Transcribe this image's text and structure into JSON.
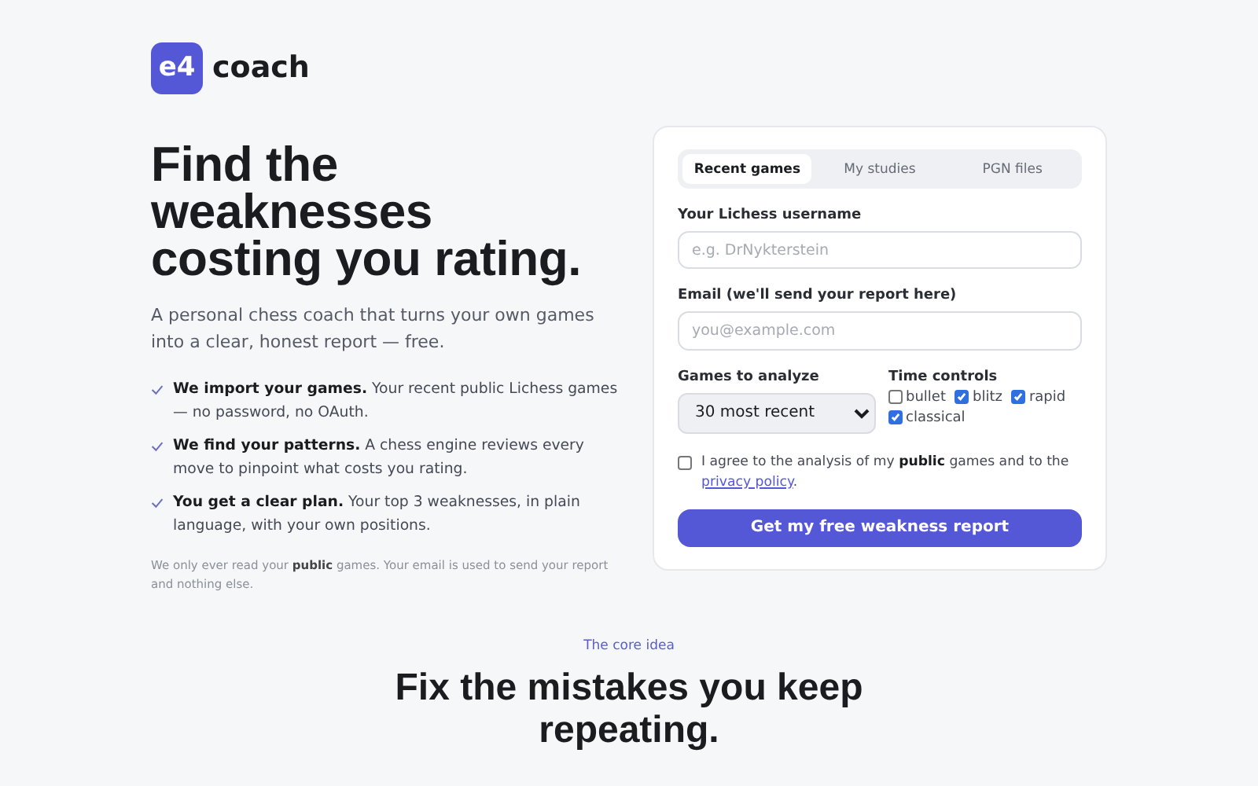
{
  "brand": {
    "mark": "e4",
    "name": "coach"
  },
  "hero": {
    "title_lines": [
      "Find the",
      "weaknesses",
      "costing you rating."
    ],
    "subtitle": "A personal chess coach that turns your own games into a clear, honest report — free.",
    "features": [
      {
        "lead": "We import your games.",
        "text": "Your recent public Lichess games — no password, no OAuth."
      },
      {
        "lead": "We find your patterns.",
        "text": "A chess engine reviews every move to pinpoint what costs you rating."
      },
      {
        "lead": "You get a clear plan.",
        "text": "Your top 3 weaknesses, in plain language, with your own positions."
      }
    ],
    "note": "We only ever read your **public** games. Your email is used to send your report and nothing else."
  },
  "form": {
    "tabs": [
      {
        "label": "Recent games",
        "selected": true
      },
      {
        "label": "My studies",
        "selected": false
      },
      {
        "label": "PGN files",
        "selected": false
      }
    ],
    "username": {
      "label": "Your Lichess username",
      "placeholder": "e.g. DrNykterstein"
    },
    "email": {
      "label": "Email (we'll send your report here)",
      "placeholder": "you@example.com"
    },
    "games": {
      "label": "Games to analyze",
      "value": "30 most recent"
    },
    "time_controls": {
      "label": "Time controls",
      "options": [
        {
          "label": "bullet",
          "checked": false
        },
        {
          "label": "blitz",
          "checked": true
        },
        {
          "label": "rapid",
          "checked": true
        },
        {
          "label": "classical",
          "checked": true
        }
      ]
    },
    "consent": {
      "checked": false,
      "text": "I agree to the analysis of my **public** games and to the",
      "link": "privacy policy",
      "after": "."
    },
    "submit": "Get my free weakness report"
  },
  "section": {
    "eyebrow": "The core idea",
    "title": "Fix the mistakes you keep repeating."
  }
}
